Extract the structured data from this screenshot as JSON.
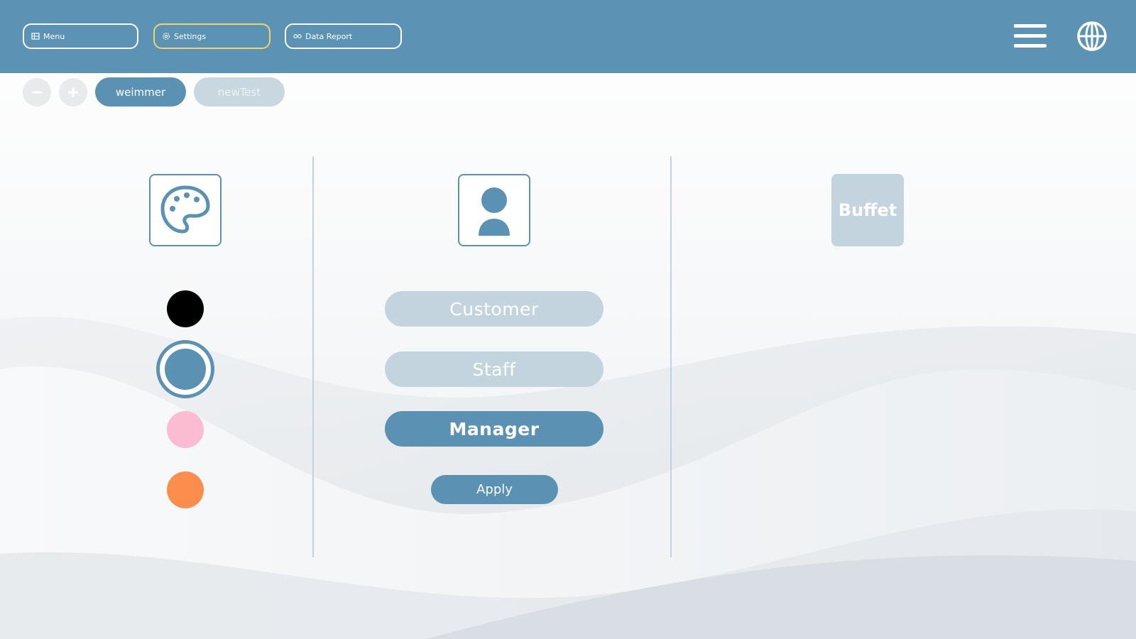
{
  "colors": {
    "accent": "#5b91b3",
    "inactive": "#c3d4df",
    "settings_highlight": "#f2d36b"
  },
  "topbar": {
    "menu_label": "Menu",
    "menu_icon": "table-icon",
    "settings_label": "Settings",
    "settings_icon": "gear-icon",
    "report_label": "Data Report",
    "report_icon": "glasses-icon",
    "right_icons": [
      "hamburger-icon",
      "globe-icon"
    ]
  },
  "toolbar": {
    "zoom_out_icon": "minus-icon",
    "zoom_in_icon": "plus-icon",
    "tabs": [
      {
        "label": "weimmer",
        "active": true
      },
      {
        "label": "newTest",
        "active": false
      }
    ]
  },
  "theme_column": {
    "icon": "palette-icon",
    "swatches": [
      {
        "name": "black",
        "color": "#000000",
        "selected": false
      },
      {
        "name": "blue",
        "color": "#5b91b3",
        "selected": true
      },
      {
        "name": "pink",
        "color": "#fbbbd0",
        "selected": false
      },
      {
        "name": "orange",
        "color": "#fc8d4c",
        "selected": false
      }
    ]
  },
  "role_column": {
    "icon": "user-icon",
    "roles": [
      {
        "label": "Customer",
        "selected": false
      },
      {
        "label": "Staff",
        "selected": false
      },
      {
        "label": "Manager",
        "selected": true
      }
    ],
    "apply_label": "Apply"
  },
  "mode_column": {
    "buffet_label": "Buffet"
  }
}
